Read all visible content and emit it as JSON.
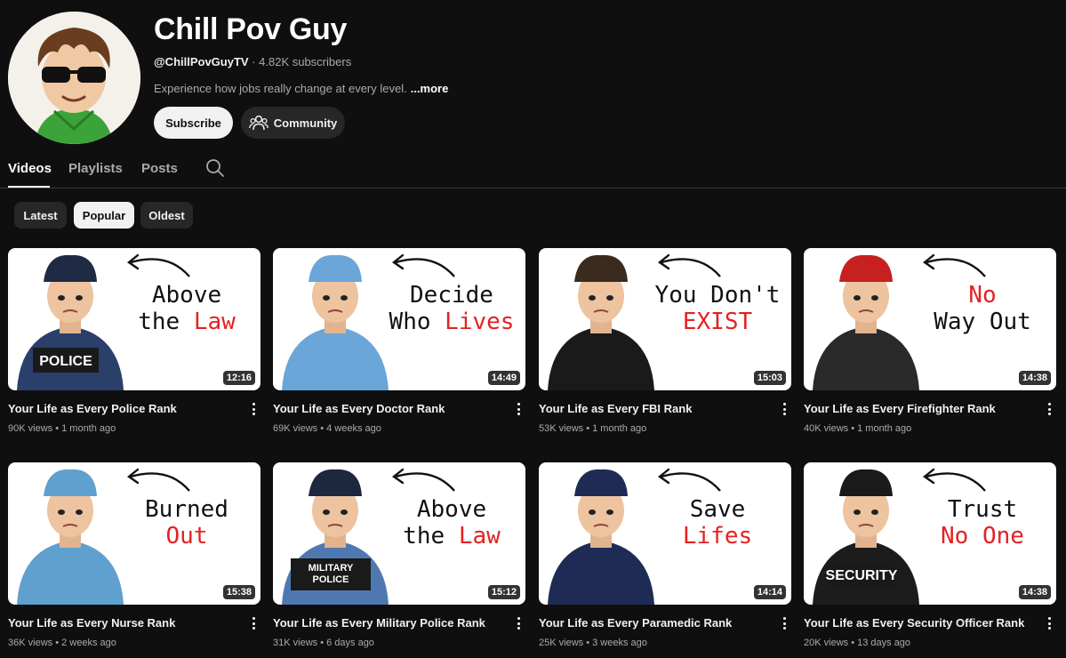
{
  "channel": {
    "name": "Chill Pov Guy",
    "handle": "@ChillPovGuyTV",
    "separator": " · ",
    "subscribers": "4.82K subscribers",
    "description": "Experience how jobs really change at every level.",
    "more": "...more",
    "subscribe_label": "Subscribe",
    "community_label": "Community"
  },
  "tabs": [
    {
      "label": "Videos",
      "active": true
    },
    {
      "label": "Playlists",
      "active": false
    },
    {
      "label": "Posts",
      "active": false
    }
  ],
  "chips": [
    {
      "label": "Latest",
      "selected": false
    },
    {
      "label": "Popular",
      "selected": true
    },
    {
      "label": "Oldest",
      "selected": false
    }
  ],
  "videos": [
    {
      "title": "Your Life as Every Police Rank",
      "views": "90K views",
      "age": "1 month ago",
      "duration": "12:16",
      "thumb_line1": "Above",
      "thumb_line2_black": "the ",
      "thumb_line2_red": "Law",
      "badge": "POLICE",
      "hat": "#1f2a44",
      "uniform": "#2b3f6b"
    },
    {
      "title": "Your Life as Every Doctor Rank",
      "views": "69K views",
      "age": "4 weeks ago",
      "duration": "14:49",
      "thumb_line1": "Decide",
      "thumb_line2_black": "Who ",
      "thumb_line2_red": "Lives",
      "badge": "",
      "hat": "#6aa6d8",
      "uniform": "#6aa6d8"
    },
    {
      "title": "Your Life as Every FBI Rank",
      "views": "53K views",
      "age": "1 month ago",
      "duration": "15:03",
      "thumb_line1": "You Don't",
      "thumb_line2_black": "",
      "thumb_line2_red": "EXIST",
      "badge": "",
      "hat": "#3b2a1e",
      "uniform": "#1a1a1a"
    },
    {
      "title": "Your Life as Every Firefighter Rank",
      "views": "40K views",
      "age": "1 month ago",
      "duration": "14:38",
      "thumb_line1_red": "No",
      "thumb_line1": "",
      "thumb_line2_black": "Way Out",
      "thumb_line2_red": "",
      "badge": "",
      "hat": "#c62020",
      "uniform": "#2a2a2a"
    },
    {
      "title": "Your Life as Every Nurse Rank",
      "views": "36K views",
      "age": "2 weeks ago",
      "duration": "15:38",
      "thumb_line1": "Burned",
      "thumb_line2_black": "",
      "thumb_line2_red": "Out",
      "badge": "",
      "hat": "#5fa0cf",
      "uniform": "#5fa0cf"
    },
    {
      "title": "Your Life as Every Military Police Rank",
      "views": "31K views",
      "age": "6 days ago",
      "duration": "15:12",
      "thumb_line1": "Above",
      "thumb_line2_black": "the ",
      "thumb_line2_red": "Law",
      "badge": "MILITARY POLICE",
      "hat": "#1d2740",
      "uniform": "#4f78b0"
    },
    {
      "title": "Your Life as Every Paramedic Rank",
      "views": "25K views",
      "age": "3 weeks ago",
      "duration": "14:14",
      "thumb_line1": "Save",
      "thumb_line2_black": "",
      "thumb_line2_red": "Lifes",
      "badge": "",
      "hat": "#1e2c55",
      "uniform": "#1e2c55"
    },
    {
      "title": "Your Life as Every Security Officer Rank",
      "views": "20K views",
      "age": "13 days ago",
      "duration": "14:38",
      "thumb_line1": "Trust",
      "thumb_line2_black": "",
      "thumb_line2_red": "No One",
      "badge": "SECURITY",
      "hat": "#1a1a1a",
      "uniform": "#1c1c1c"
    }
  ],
  "colors": {
    "background": "#0f0f0f",
    "accent_red": "#e32222",
    "chip_bg": "#272727"
  }
}
